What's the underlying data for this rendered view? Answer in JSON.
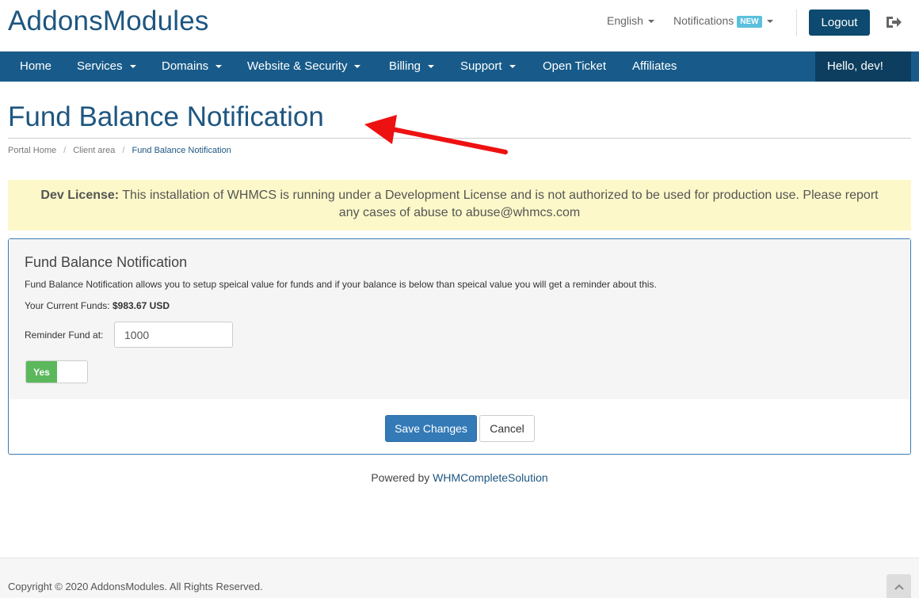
{
  "header": {
    "logo": "AddonsModules",
    "language": "English",
    "notifications": "Notifications",
    "notifications_badge": "NEW",
    "logout": "Logout"
  },
  "nav": {
    "items": [
      {
        "label": "Home",
        "has_caret": false
      },
      {
        "label": "Services",
        "has_caret": true
      },
      {
        "label": "Domains",
        "has_caret": true
      },
      {
        "label": "Website & Security",
        "has_caret": true
      },
      {
        "label": "Billing",
        "has_caret": true
      },
      {
        "label": "Support",
        "has_caret": true
      },
      {
        "label": "Open Ticket",
        "has_caret": false
      },
      {
        "label": "Affiliates",
        "has_caret": false
      }
    ],
    "user": "Hello, dev!"
  },
  "page": {
    "title": "Fund Balance Notification"
  },
  "breadcrumb": [
    "Portal Home",
    "Client area",
    "Fund Balance Notification"
  ],
  "dev_license": {
    "label": "Dev License:",
    "text": "This installation of WHMCS is running under a Development License and is not authorized to be used for production use. Please report any cases of abuse to abuse@whmcs.com"
  },
  "panel": {
    "title": "Fund Balance Notification",
    "description": "Fund Balance Notification allows you to setup speical value for funds and if your balance is below than speical value you will get a reminder about this.",
    "funds_label": "Your Current Funds:",
    "funds_value": "$983.67 USD",
    "reminder_label": "Reminder Fund at:",
    "reminder_value": "1000",
    "toggle_label": "Yes",
    "save": "Save Changes",
    "cancel": "Cancel"
  },
  "powered": {
    "prefix": "Powered by",
    "link": "WHMCompleteSolution"
  },
  "footer": {
    "copyright": "Copyright © 2020 AddonsModules. All Rights Reserved."
  },
  "colors": {
    "brand": "#1e5680",
    "navbar": "#185b8a",
    "annotation_arrow": "#ee1111",
    "toggle_on": "#5cb85c",
    "primary_button": "#337ab7"
  }
}
